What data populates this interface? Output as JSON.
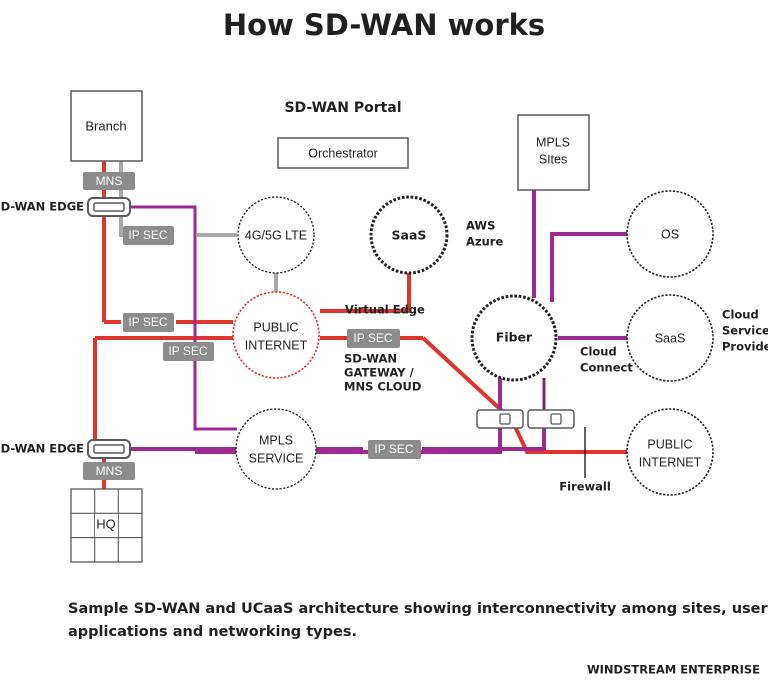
{
  "page": {
    "title": "How SD-WAN works",
    "caption_line1": "Sample SD-WAN and UCaaS architecture showing interconnectivity among sites, users,",
    "caption_line2": "applications and networking types.",
    "footer_brand": "WINDSTREAM ENTERPRISE"
  },
  "colors": {
    "red": "#e0342a",
    "purple": "#9c2a92",
    "gray_line": "#a7a9ac",
    "badge_gray": "#8c8c8c",
    "ink": "#231f20",
    "box_stroke": "#58595b"
  },
  "portal": {
    "heading": "SD-WAN Portal",
    "orchestrator_label": "Orchestrator"
  },
  "sites": {
    "branch_label": "Branch",
    "hq_label": "HQ",
    "mpls_sites_line1": "MPLS",
    "mpls_sites_line2": "SItes"
  },
  "edges": {
    "edge_top_label": "SD-WAN EDGE",
    "edge_bottom_label": "SD-WAN EDGE",
    "mns_top_label": "MNS",
    "mns_bottom_label": "MNS"
  },
  "clouds": [
    {
      "id": "lte",
      "line1": "4G/5G LTE",
      "line2": "",
      "style": "thin"
    },
    {
      "id": "saas-top",
      "line1": "SaaS",
      "line2": "",
      "style": "bold"
    },
    {
      "id": "public-net",
      "line1": "PUBLIC",
      "line2": "INTERNET",
      "style": "red"
    },
    {
      "id": "mpls-svc",
      "line1": "MPLS",
      "line2": "SERVICE",
      "style": "thin"
    },
    {
      "id": "fiber",
      "line1": "Fiber",
      "line2": "",
      "style": "bold"
    },
    {
      "id": "os",
      "line1": "OS",
      "line2": "",
      "style": "thin"
    },
    {
      "id": "saas-right",
      "line1": "SaaS",
      "line2": "",
      "style": "thin"
    },
    {
      "id": "public-net-right",
      "line1": "PUBLIC",
      "line2": "INTERNET",
      "style": "thin"
    }
  ],
  "ipsec_badges": [
    {
      "id": "ipsec-branch",
      "label": "IP SEC"
    },
    {
      "id": "ipsec-mid-1",
      "label": "IP SEC"
    },
    {
      "id": "ipsec-mid-2",
      "label": "IP SEC"
    },
    {
      "id": "ipsec-gateway",
      "label": "IP SEC"
    },
    {
      "id": "ipsec-mpls",
      "label": "IP SEC"
    }
  ],
  "annotations": {
    "aws_line1": "AWS",
    "aws_line2": "Azure",
    "virtual_edge": "Virtual Edge",
    "gateway_line1": "SD-WAN",
    "gateway_line2": "GATEWAY /",
    "gateway_line3": "MNS CLOUD",
    "cloud_connect_line1": "Cloud",
    "cloud_connect_line2": "Connect",
    "csp_line1": "Cloud",
    "csp_line2": "Service",
    "csp_line3": "Provider",
    "firewall": "Firewall"
  }
}
